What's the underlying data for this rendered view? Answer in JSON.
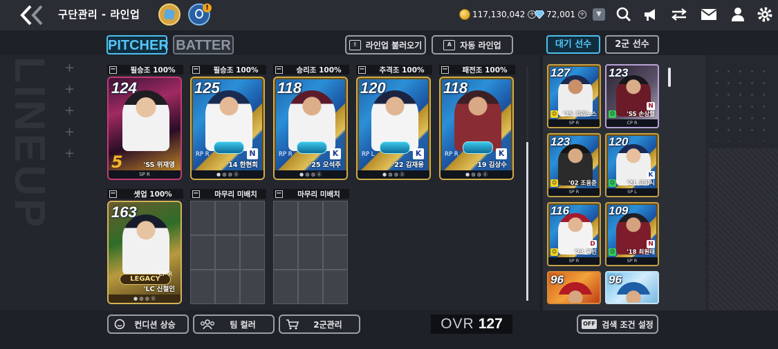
{
  "header": {
    "title": "구단관리 - 라인업",
    "badge": "!",
    "gold": "117,130,042",
    "diamond": "72,001",
    "plus": "+"
  },
  "tabs": {
    "pitcher": "PITCHER",
    "batter": "BATTER"
  },
  "buttons": {
    "load_lineup": "라인업 불러오기",
    "auto_lineup": "자동 라인업"
  },
  "watermark": "LINEUP",
  "slots_top": [
    {
      "role": "필승조",
      "pct": "100%",
      "ovr": "124",
      "name": "'SS 위재영",
      "pos": "SP R",
      "theme": "purple"
    },
    {
      "role": "필승조",
      "pct": "100%",
      "ovr": "125",
      "name": "'14 한현희",
      "pos": "RP R",
      "theme": "blue",
      "team": "N"
    },
    {
      "role": "승리조",
      "pct": "100%",
      "ovr": "118",
      "name": "'25 오석주",
      "pos": "RP R",
      "theme": "blue",
      "team": "K"
    },
    {
      "role": "추격조",
      "pct": "100%",
      "ovr": "120",
      "name": "'22 김재웅",
      "pos": "RP L",
      "theme": "blue",
      "team": "K"
    },
    {
      "role": "패전조",
      "pct": "100%",
      "ovr": "118",
      "name": "'19 김상수",
      "pos": "RP R",
      "theme": "blue",
      "team": "K"
    }
  ],
  "slots_bottom": [
    {
      "role": "셋업",
      "pct": "100%",
      "ovr": "163",
      "name": "'LC 신철인",
      "pos": "CP R",
      "tag": "LEGACY",
      "theme": "legacy"
    },
    {
      "role": "마무리",
      "pct": "미배치"
    },
    {
      "role": "마무리",
      "pct": "미배치"
    }
  ],
  "right_tabs": {
    "waiting": "대기 선수",
    "second": "2군 선수"
  },
  "bench": [
    {
      "ovr": "127",
      "name": "'25 치리노스",
      "pos": "SP R",
      "bg": "blue"
    },
    {
      "ovr": "123",
      "name": "'SS 손상렬",
      "pos": "CP R",
      "bg": "dark",
      "team": "N"
    },
    {
      "ovr": "123",
      "name": "'02 조용준",
      "pos": "SP R",
      "bg": "blue"
    },
    {
      "ovr": "120",
      "name": "'21 요키시",
      "pos": "SP L",
      "bg": "blue",
      "team": "K"
    },
    {
      "ovr": "116",
      "name": "'23 곽빈",
      "pos": "SP R",
      "bg": "blue",
      "team": "D"
    },
    {
      "ovr": "109",
      "name": "'18 최원태",
      "pos": "SP R",
      "bg": "blue",
      "team": "N"
    },
    {
      "ovr": "96",
      "name": "",
      "pos": "",
      "bg": "orange"
    },
    {
      "ovr": "96",
      "name": "",
      "pos": "",
      "bg": "sky"
    }
  ],
  "bottom": {
    "condition": "컨디션 상승",
    "team_color": "팀 컬러",
    "second_mgmt": "2군관리",
    "ovr_label": "OVR",
    "ovr_value": "127",
    "filter_tag": "OFF",
    "filter": "검색 조건 설정"
  },
  "colors": {
    "accent": "#4fc1f0",
    "gold": "#c6a247",
    "panel": "#2b2e35"
  }
}
